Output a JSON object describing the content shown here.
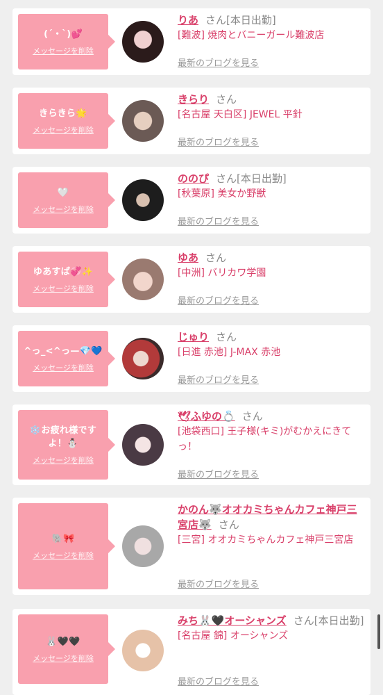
{
  "delete_label": "メッセージを削除",
  "blog_label": "最新のブログを見る",
  "san": "さん",
  "cards": [
    {
      "message": "(ˊ・ˋ)💕",
      "name": "りあ",
      "status": "[本日出勤]",
      "shop": "[難波] 焼肉とバニーガール難波店"
    },
    {
      "message": "きらきら🌟",
      "name": "きらり",
      "status": "",
      "shop": "[名古屋 天白区] JEWEL 平針"
    },
    {
      "message": "🤍",
      "name": "ののぴ",
      "status": "[本日出勤]",
      "shop": "[秋葉原] 美女か野獣"
    },
    {
      "message": "ゆあすぱ💞✨",
      "name": "ゆあ",
      "status": "",
      "shop": "[中洲] バリカワ学園"
    },
    {
      "message": "^っ_<^っ—💎💙",
      "name": "じゅり",
      "status": "",
      "shop": "[日進 赤池] J-MAX 赤池"
    },
    {
      "message": "❄️お疲れ様ですよ！⛄",
      "name": "🕊ふゆの💍",
      "status": "",
      "shop": "[池袋西口] 王子様(キミ)がむかえにきてっ！"
    },
    {
      "message": "🐘🎀",
      "name": "かのん🐺オオカミちゃんカフェ神戸三宮店🐺",
      "status": "",
      "shop": "[三宮] オオカミちゃんカフェ神戸三宮店"
    },
    {
      "message": "🐰🖤🖤",
      "name": "みち🐰🖤オーシャンズ",
      "status": "[本日出勤]",
      "shop": "[名古屋 錦] オーシャンズ"
    }
  ],
  "colors": {
    "accent": "#d9406a",
    "bubble": "#f9a0ae",
    "background": "#efefef"
  }
}
